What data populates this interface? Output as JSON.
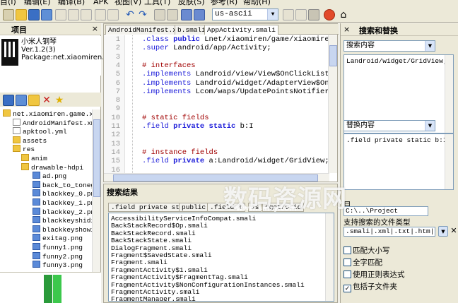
{
  "menubar": {
    "items": [
      "目(I)",
      "编辑(E)",
      "编译(B)",
      "APK",
      "视图(V)",
      "工具(T)",
      "皮肤(S)",
      "参考(R)",
      "帮助(H)"
    ]
  },
  "toolbar": {
    "encoding": "us-ascii"
  },
  "project_panel": {
    "title": "项目",
    "close": "×",
    "app_name": "小米人钢琴",
    "app_version": "Ver.1.2(3)",
    "app_package": "Package:net.xiaomiren.g",
    "tree": [
      {
        "label": "net.xiaomiren.game.xia",
        "type": "folder"
      },
      {
        "label": "AndroidManifest.xml",
        "type": "file"
      },
      {
        "label": "apktool.yml",
        "type": "file"
      },
      {
        "label": "assets",
        "type": "folder"
      },
      {
        "label": "res",
        "type": "folder"
      },
      {
        "label": "anim",
        "type": "folder"
      },
      {
        "label": "drawable-hdpi",
        "type": "folder"
      },
      {
        "label": "ad.png",
        "type": "img"
      },
      {
        "label": "back_to_toneg",
        "type": "img"
      },
      {
        "label": "blackkey_0.pn",
        "type": "img"
      },
      {
        "label": "blackkey_1.pn",
        "type": "img"
      },
      {
        "label": "blackkey_2.pn",
        "type": "img"
      },
      {
        "label": "blackkeyshidin",
        "type": "img"
      },
      {
        "label": "blackkeyshowi",
        "type": "img"
      },
      {
        "label": "exitag.png",
        "type": "img"
      },
      {
        "label": "funny1.png",
        "type": "img"
      },
      {
        "label": "funny2.png",
        "type": "img"
      },
      {
        "label": "funny3.png",
        "type": "img"
      }
    ]
  },
  "editor": {
    "tabs": [
      "AndroidManifest.xml",
      "b.smali",
      "AppActivity.smali"
    ],
    "line_numbers": [
      "1",
      "2",
      "3",
      "4",
      "5",
      "6",
      "7",
      "8",
      "9",
      "10",
      "11",
      "12",
      "13",
      "14",
      "15",
      "16"
    ],
    "lines": [
      [
        {
          "t": ".class ",
          "c": "dir"
        },
        {
          "t": "public ",
          "c": "kw"
        },
        {
          "t": "Lnet/xiaomiren/game/xiaomire",
          "c": "pl"
        }
      ],
      [
        {
          "t": ".super ",
          "c": "dir"
        },
        {
          "t": "Landroid/app/Activity;",
          "c": "pl"
        }
      ],
      [],
      [
        {
          "t": "# interfaces",
          "c": "cm"
        }
      ],
      [
        {
          "t": ".implements ",
          "c": "dir"
        },
        {
          "t": "Landroid/view/View$OnClickListe",
          "c": "pl"
        }
      ],
      [
        {
          "t": ".implements ",
          "c": "dir"
        },
        {
          "t": "Landroid/widget/AdapterView$On",
          "c": "pl"
        }
      ],
      [
        {
          "t": ".implements ",
          "c": "dir"
        },
        {
          "t": "Lcom/waps/UpdatePointsNotifier",
          "c": "pl"
        }
      ],
      [],
      [],
      [
        {
          "t": "# static fields",
          "c": "cm"
        }
      ],
      [
        {
          "t": ".field ",
          "c": "dir"
        },
        {
          "t": "private static ",
          "c": "kw"
        },
        {
          "t": "b:I",
          "c": "pl"
        }
      ],
      [],
      [],
      [
        {
          "t": "# instance fields",
          "c": "cm"
        }
      ],
      [
        {
          "t": ".field ",
          "c": "dir"
        },
        {
          "t": "private ",
          "c": "kw"
        },
        {
          "t": "a:Landroid/widget/GridView;",
          "c": "pl"
        }
      ],
      []
    ]
  },
  "results": {
    "title": "搜索结果",
    "tabs": [
      ".field private stati",
      "public",
      ".field l",
      "ss",
      "dget/Grid"
    ],
    "items": [
      "AccessibilityServiceInfoCompat.smali",
      "BackStackRecord$Op.smali",
      "BackStackRecord.smali",
      "BackStackState.smali",
      "DialogFragment.smali",
      "Fragment$SavedState.smali",
      "Fragment.smali",
      "FragmentActivity$1.smali",
      "FragmentActivity$FragmentTag.smali",
      "FragmentActivity$NonConfigurationInstances.smali",
      "FragmentActivity.smali",
      "FragmentManager.smali"
    ]
  },
  "search_panel": {
    "title": "搜索和替换",
    "close": "×",
    "search_label": "搜索内容",
    "search_value": "Landroid/widget/GridView;",
    "replace_label": "替换内容",
    "replace_value": ".field private static b:I",
    "dir_label": "目",
    "dir_value": "C:\\..\\Project",
    "filetype_label": "支持搜索的文件类型",
    "filetype_value": ".smali|.xml|.txt|.htm|.html",
    "options": [
      {
        "label": "匹配大小写",
        "checked": false
      },
      {
        "label": "全字匹配",
        "checked": false
      },
      {
        "label": "使用正则表达式",
        "checked": false
      },
      {
        "label": "包括子文件夹",
        "checked": true
      }
    ]
  },
  "watermark": {
    "text": "数码资源网",
    "sub": "www.smzy.com"
  },
  "colors": {
    "keyword": "#1b1bd9",
    "comment": "#a00000",
    "panel": "#ece9d8"
  }
}
